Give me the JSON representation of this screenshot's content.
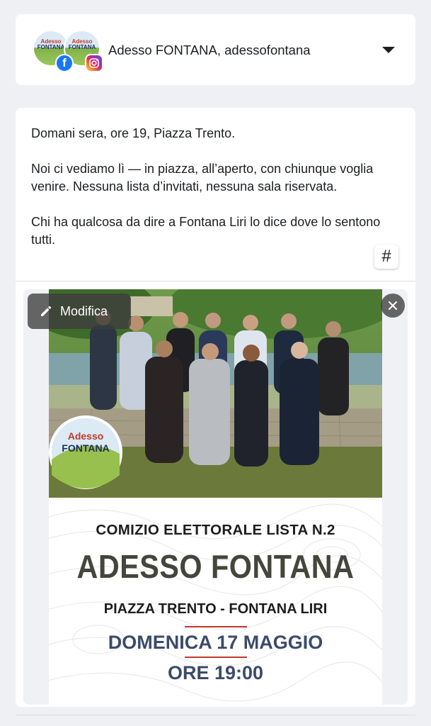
{
  "account": {
    "name": "Adesso FONTANA, adessofontana",
    "logo_line1": "Adesso",
    "logo_line2": "FONTANA",
    "facebook_badge": "f"
  },
  "post": {
    "paragraphs": [
      "Domani sera, ore 19, Piazza Trento.",
      "Noi ci vediamo lì — in piazza, all’aperto, con chiunque voglia venire. Nessuna lista d’invitati, nessuna sala riservata.",
      "Chi ha qualcosa da dire a Fontana Liri lo dice dove lo sentono tutti."
    ],
    "hashtag_label": "#"
  },
  "media": {
    "edit_label": "Modifica",
    "poster": {
      "logo_line1": "Adesso",
      "logo_line2": "FONTANA",
      "line1": "COMIZIO ELETTORALE LISTA N.2",
      "line2": "ADESSO FONTANA",
      "line3": "PIAZZA TRENTO - FONTANA LIRI",
      "line4": "DOMENICA 17 MAGGIO",
      "line5": "ORE 19:00"
    }
  },
  "colors": {
    "background": "#eef0f4",
    "card": "#ffffff",
    "facebook": "#1877f2",
    "poster_red": "#c0392b",
    "poster_blue": "#3d4a6b",
    "poster_title": "#44463c"
  }
}
